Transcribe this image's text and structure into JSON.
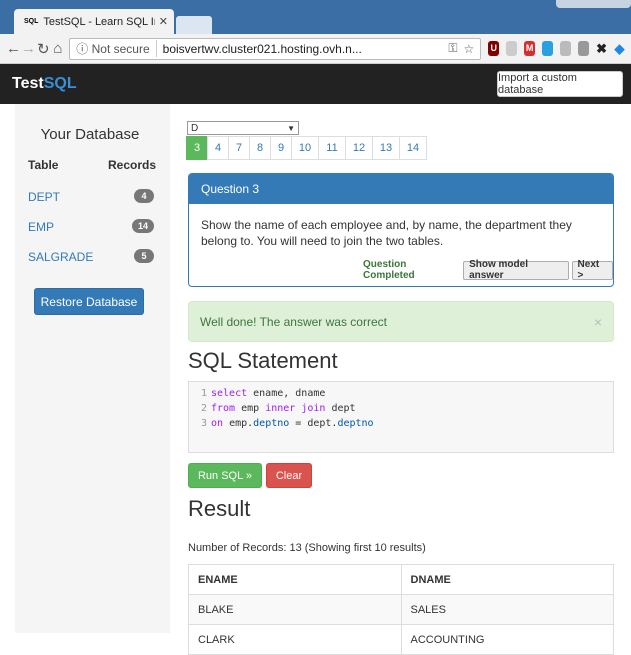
{
  "browser": {
    "tab_title": "TestSQL - Learn SQL Inte",
    "tab_favicon": "SQL",
    "security": "Not secure",
    "url": "boisvertwv.cluster021.hosting.ovh.n..."
  },
  "navbar": {
    "brand_test": "Test",
    "brand_sql": "SQL",
    "import_label": "Import a custom database"
  },
  "sidebar": {
    "title": "Your Database",
    "col_table": "Table",
    "col_records": "Records",
    "tables": [
      {
        "name": "DEPT",
        "count": "4"
      },
      {
        "name": "EMP",
        "count": "14"
      },
      {
        "name": "SALGRADE",
        "count": "5"
      }
    ],
    "restore_label": "Restore Database"
  },
  "main": {
    "db_select": "D",
    "question_tabs": [
      "3",
      "4",
      "7",
      "8",
      "9",
      "10",
      "11",
      "12",
      "13",
      "14"
    ],
    "active_question": "3",
    "question": {
      "title": "Question 3",
      "text": "Show the name of each employee and, by name, the department they belong to. You will need to join the two tables.",
      "completed": "Question Completed",
      "model_answer_label": "Show model answer",
      "next_label": "Next >"
    },
    "alert": "Well done! The answer was correct",
    "alert_close": "×",
    "sql_title": "SQL Statement",
    "code_lines": [
      {
        "n": "1",
        "kw1": "select",
        "rest": " ename, dname"
      },
      {
        "n": "2",
        "kw1": "from",
        "mid": " emp ",
        "kw2": "inner",
        "sp": " ",
        "kw3": "join",
        "rest": " dept"
      },
      {
        "n": "3",
        "kw1": "on",
        "a": " emp.",
        "c1": "deptno",
        "b": " = dept.",
        "c2": "deptno"
      }
    ],
    "run_label": "Run SQL »",
    "clear_label": "Clear",
    "result_title": "Result",
    "record_count": "Number of Records: 13 (Showing first 10 results)",
    "columns": [
      "ENAME",
      "DNAME"
    ],
    "rows": [
      [
        "BLAKE",
        "SALES"
      ],
      [
        "CLARK",
        "ACCOUNTING"
      ]
    ]
  },
  "colors": {
    "primary": "#337ab7",
    "success": "#5cb85c",
    "danger": "#d9534f",
    "navbar": "#222222"
  }
}
